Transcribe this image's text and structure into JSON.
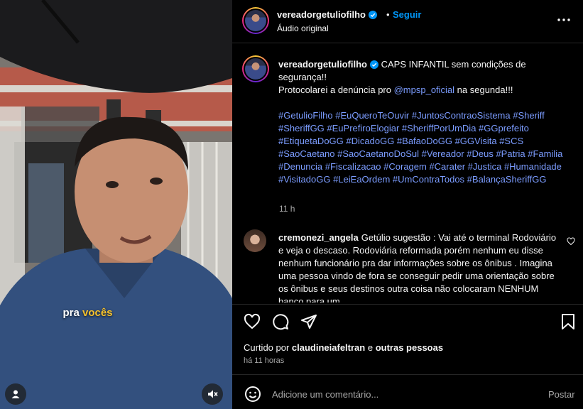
{
  "video": {
    "caption_prefix": "pra ",
    "caption_highlight": "vocês"
  },
  "header": {
    "username": "vereadorgetuliofilho",
    "separator": "•",
    "follow_label": "Seguir",
    "audio_label": "Áudio original"
  },
  "post": {
    "username": "vereadorgetuliofilho",
    "text_line1": "CAPS INFANTIL sem condições de segurança!!",
    "text_line2_pre": "Protocolarei a denúncia pro ",
    "mention": "@mpsp_oficial",
    "text_line2_post": " na segunda!!!",
    "hashtags": "#GetulioFilho #EuQueroTeOuvir #JuntosContraoSistema #Sheriff #SheriffGG #EuPrefiroElogiar #SheriffPorUmDia #GGprefeito #EtiquetaDoGG #DicadoGG #BafaoDoGG #GGVisita #SCS #SaoCaetano #SaoCaetanoDoSul #Vereador #Deus #Patria #Familia #Denuncia #Fiscalizacao #Coragem #Carater #Justica #Humanidade #VisitadoGG #LeiEaOrdem #UmContraTodos #BalançaSheriffGG",
    "time": "11 h"
  },
  "comment": {
    "username": "cremonezi_angela",
    "text": "Getúlio sugestão : Vai até o terminal Rodoviário e veja o descaso. Rodoviária reformada porém nenhum eu disse nenhum funcionário pra dar informações sobre os ônibus . Imagina uma pessoa vindo de fora se conseguir pedir uma orientação sobre os ônibus e seus destinos outra coisa não colocaram NENHUM banco para um"
  },
  "likes": {
    "prefix": "Curtido por ",
    "user": "claudineiafeltran",
    "middle": " e ",
    "others": "outras pessoas"
  },
  "posted_ago": "há 11 horas",
  "composer": {
    "placeholder": "Adicione um comentário...",
    "post_label": "Postar"
  },
  "colors": {
    "background": "#000000",
    "link": "#0095f6",
    "hashtag": "#7b9cff",
    "muted": "#a8a8a8"
  },
  "icons": [
    "verified-badge-icon",
    "more-options-icon",
    "heart-icon",
    "comment-icon",
    "share-icon",
    "bookmark-icon",
    "emoji-icon",
    "user-icon",
    "muted-speaker-icon"
  ]
}
